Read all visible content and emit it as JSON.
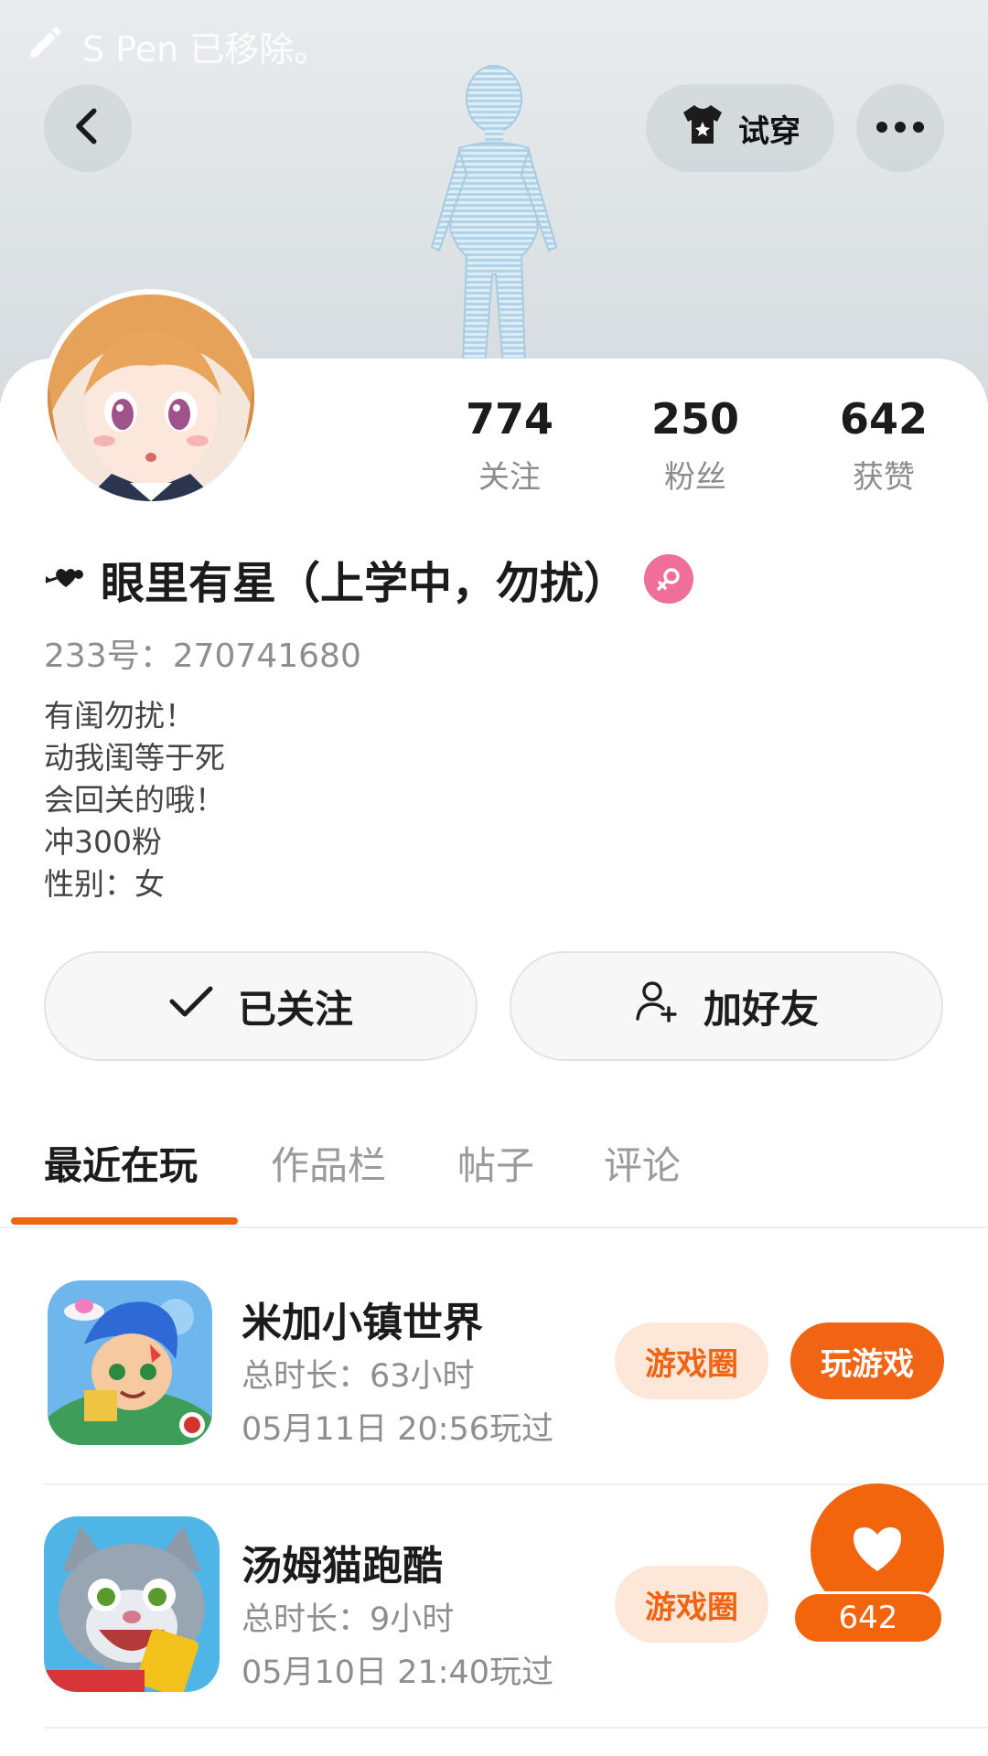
{
  "system": {
    "spen_notice": "S Pen 已移除。"
  },
  "header": {
    "tryon_label": "试穿"
  },
  "profile": {
    "name": "眼里有星（上学中，勿扰）",
    "uid": "233号：270741680",
    "gender": "female",
    "stats": [
      {
        "value": "774",
        "label": "关注"
      },
      {
        "value": "250",
        "label": "粉丝"
      },
      {
        "value": "642",
        "label": "获赞"
      }
    ],
    "bio": [
      "有闺勿扰！",
      "动我闺等于死",
      "会回关的哦！",
      "冲300粉",
      "性别：女"
    ]
  },
  "actions": {
    "follow_label": "已关注",
    "add_friend_label": "加好友"
  },
  "tabs": [
    "最近在玩",
    "作品栏",
    "帖子",
    "评论"
  ],
  "games": [
    {
      "title": "米加小镇世界",
      "duration": "总时长：63小时",
      "last_played": "05月11日 20:56玩过",
      "circle_label": "游戏圈",
      "play_label": "玩游戏"
    },
    {
      "title": "汤姆猫跑酷",
      "duration": "总时长：9小时",
      "last_played": "05月10日 21:40玩过",
      "circle_label": "游戏圈"
    }
  ],
  "like_fab": {
    "count": "642"
  },
  "colors": {
    "accent": "#f06414",
    "gender_badge": "#f06f98"
  }
}
